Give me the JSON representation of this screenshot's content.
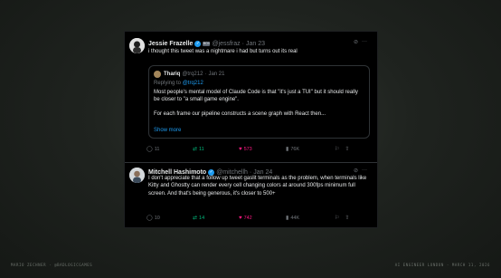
{
  "tweets": [
    {
      "name": "Jessie Frazelle",
      "badge": "BOX",
      "handle": "@jessfraz",
      "sep": "·",
      "date": "Jan 23",
      "text": "i thought this tweet was a nightmare i had but turns out its real",
      "quote": {
        "name": "Thariq",
        "handle": "@trq212",
        "sep": "·",
        "date": "Jan 21",
        "replying_prefix": "Replying to ",
        "replying_handle": "@trq212",
        "text_1": "Most people's mental model of Claude Code is that \"it's just a TUI\" but it should really be closer to \"a small game engine\".",
        "text_2": "For each frame our pipeline constructs a scene graph with React then...",
        "show_more": "Show more"
      },
      "actions": {
        "replies": "11",
        "reposts": "11",
        "likes": "573",
        "views": "76K"
      }
    },
    {
      "name": "Mitchell Hashimoto",
      "handle": "@mitchellh",
      "sep": "·",
      "date": "Jan 24",
      "text": "I don't appreciate that a follow up tweet gaslit terminals as the problem, when terminals like Kitty and Ghostty can render every cell changing colors at around 300fps minimum full screen. And that's being generous, it's closer to 500+",
      "actions": {
        "replies": "10",
        "reposts": "14",
        "likes": "742",
        "views": "44K"
      }
    }
  ],
  "footer": {
    "left": "MARIO ZECHNER · @BADLOGICGAMES",
    "right": "AI ENGINEER LONDON · MARCH 11, 2026"
  },
  "icons": [
    "grok-icon",
    "more-icon",
    "reply-icon",
    "repost-icon",
    "like-icon",
    "views-icon",
    "bookmark-icon",
    "share-icon"
  ],
  "colors": {
    "background": "#1f231f",
    "card": "#000000",
    "link": "#1d9bf0",
    "repost": "#00ba7c",
    "like": "#f91880",
    "muted": "#71767b"
  }
}
